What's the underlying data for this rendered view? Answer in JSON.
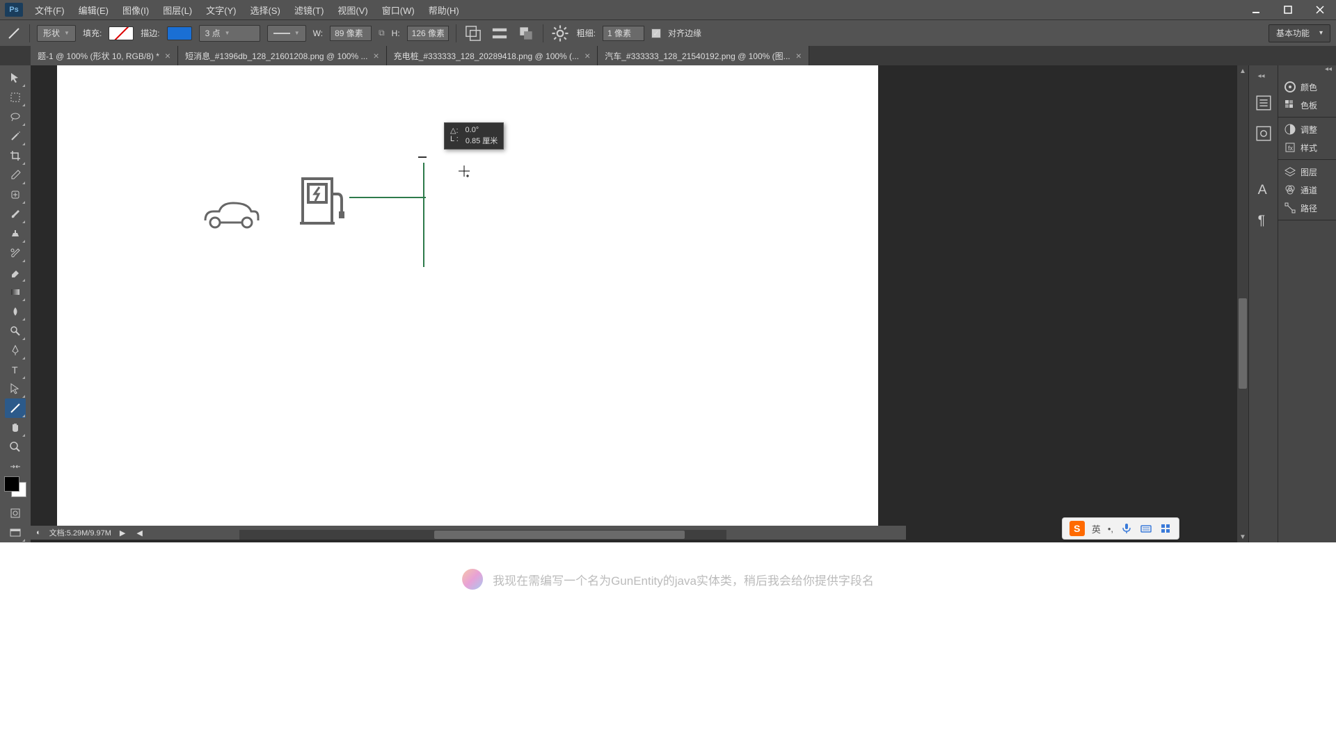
{
  "app": {
    "logo": "Ps"
  },
  "menu": [
    "文件(F)",
    "编辑(E)",
    "图像(I)",
    "图层(L)",
    "文字(Y)",
    "选择(S)",
    "滤镜(T)",
    "视图(V)",
    "窗口(W)",
    "帮助(H)"
  ],
  "options": {
    "shape_mode": "形状",
    "fill_label": "填充:",
    "stroke_label": "描边:",
    "stroke_width": "3 点",
    "w_label": "W:",
    "w_value": "89 像素",
    "h_label": "H:",
    "h_value": "126 像素",
    "thickness_label": "粗细:",
    "thickness_value": "1 像素",
    "align_edges": "对齐边缘",
    "workspace": "基本功能"
  },
  "tabs": [
    {
      "label": "题-1 @ 100% (形状 10, RGB/8) *"
    },
    {
      "label": "短消息_#1396db_128_21601208.png @ 100% ..."
    },
    {
      "label": "充电桩_#333333_128_20289418.png @ 100% (..."
    },
    {
      "label": "汽车_#333333_128_21540192.png @ 100% (图..."
    }
  ],
  "tooltip": {
    "angle_label": "△:",
    "angle_value": "0.0°",
    "length_label": "L :",
    "length_value": "0.85 厘米"
  },
  "status": {
    "doc_label": "文档:",
    "doc_value": "5.29M/9.97M"
  },
  "right_panels": {
    "group1": [
      "颜色",
      "色板"
    ],
    "group2": [
      "调整",
      "样式"
    ],
    "group3": [
      "图层",
      "通道",
      "路径"
    ]
  },
  "ime": {
    "lang": "英"
  },
  "bottom_text": "我现在需编写一个名为GunEntity的java实体类，稍后我会给你提供字段名",
  "colors": {
    "stroke_blue": "#1a6fd4",
    "shape_green": "#2d7a4a"
  }
}
